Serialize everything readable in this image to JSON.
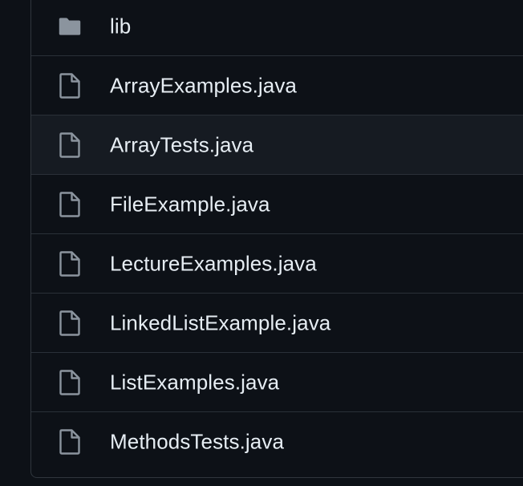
{
  "file_list": {
    "items": [
      {
        "name": "lib",
        "type": "folder",
        "icon": "folder-icon"
      },
      {
        "name": "ArrayExamples.java",
        "type": "file",
        "icon": "file-icon"
      },
      {
        "name": "ArrayTests.java",
        "type": "file",
        "icon": "file-icon"
      },
      {
        "name": "FileExample.java",
        "type": "file",
        "icon": "file-icon"
      },
      {
        "name": "LectureExamples.java",
        "type": "file",
        "icon": "file-icon"
      },
      {
        "name": "LinkedListExample.java",
        "type": "file",
        "icon": "file-icon"
      },
      {
        "name": "ListExamples.java",
        "type": "file",
        "icon": "file-icon"
      },
      {
        "name": "MethodsTests.java",
        "type": "file",
        "icon": "file-icon"
      }
    ],
    "hovered_index": 2
  },
  "colors": {
    "background": "#0d1117",
    "row_hover": "#161b22",
    "border": "#30363d",
    "text": "#e6edf3",
    "icon": "#8b949e"
  }
}
